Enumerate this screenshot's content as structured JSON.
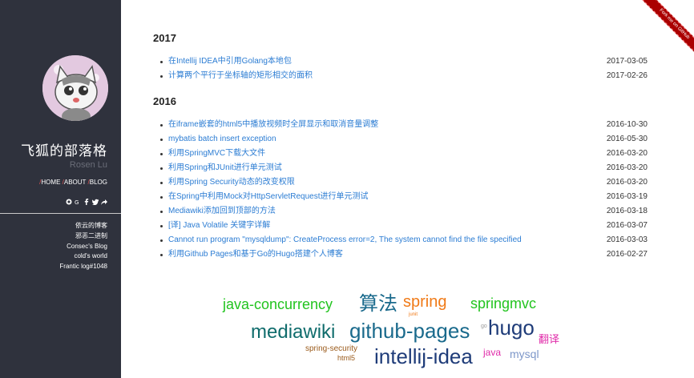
{
  "sidebar": {
    "title": "飞狐的部落格",
    "subtitle": "Rosen Lu",
    "nav": [
      {
        "label": "HOME"
      },
      {
        "label": "ABOUT"
      },
      {
        "label": "BLOG"
      }
    ],
    "social_icons": [
      "github-icon",
      "google-plus-icon",
      "facebook-icon",
      "twitter-icon",
      "share-icon"
    ],
    "links": [
      "依云的博客",
      "邪恶二进制",
      "Consec's Blog",
      "cold's world",
      "Frantic log#1048"
    ]
  },
  "ribbon": {
    "label": "Fork me on GitHub"
  },
  "archive": [
    {
      "year": "2017",
      "posts": [
        {
          "title": "在Intellij IDEA中引用Golang本地包",
          "date": "2017-03-05"
        },
        {
          "title": "计算两个平行于坐标轴的矩形相交的面积",
          "date": "2017-02-26"
        }
      ]
    },
    {
      "year": "2016",
      "posts": [
        {
          "title": "在iframe嵌套的html5中播放视频时全屏显示和取消音量调整",
          "date": "2016-10-30"
        },
        {
          "title": "mybatis batch insert exception",
          "date": "2016-05-30"
        },
        {
          "title": "利用SpringMVC下载大文件",
          "date": "2016-03-20"
        },
        {
          "title": "利用Spring和JUnit进行单元测试",
          "date": "2016-03-20"
        },
        {
          "title": "利用Spring Security动态的改变权限",
          "date": "2016-03-20"
        },
        {
          "title": "在Spring中利用Mock对HttpServletRequest进行单元测试",
          "date": "2016-03-19"
        },
        {
          "title": "Mediawiki添加回到顶部的方法",
          "date": "2016-03-18"
        },
        {
          "title": "[译] Java Volatile 关键字详解",
          "date": "2016-03-07"
        },
        {
          "title": "Cannot run program \"mysqldump\": CreateProcess error=2, The system cannot find the file specified",
          "date": "2016-03-03"
        },
        {
          "title": "利用Github Pages和基于Go的Hugo搭建个人博客",
          "date": "2016-02-27"
        }
      ]
    }
  ],
  "tags": [
    {
      "label": "java-concurrency",
      "color": "#22c41f"
    },
    {
      "label": "算法",
      "color": "#1a6a8c"
    },
    {
      "label": "spring",
      "color": "#f07a17"
    },
    {
      "label": "springmvc",
      "color": "#22c41f"
    },
    {
      "label": "junit",
      "color": "#f07a17"
    },
    {
      "label": "mediawiki",
      "color": "#0f6c6c"
    },
    {
      "label": "github-pages",
      "color": "#1a6a8c"
    },
    {
      "label": "go",
      "color": "#9a9a9a"
    },
    {
      "label": "hugo",
      "color": "#1f3c79"
    },
    {
      "label": "翻译",
      "color": "#e02aa9"
    },
    {
      "label": "spring-security",
      "color": "#9a5a1a"
    },
    {
      "label": "html5",
      "color": "#9a5a1a"
    },
    {
      "label": "intellij-idea",
      "color": "#1f3c79"
    },
    {
      "label": "java",
      "color": "#e02aa9"
    },
    {
      "label": "mysql",
      "color": "#7d97c9"
    }
  ]
}
